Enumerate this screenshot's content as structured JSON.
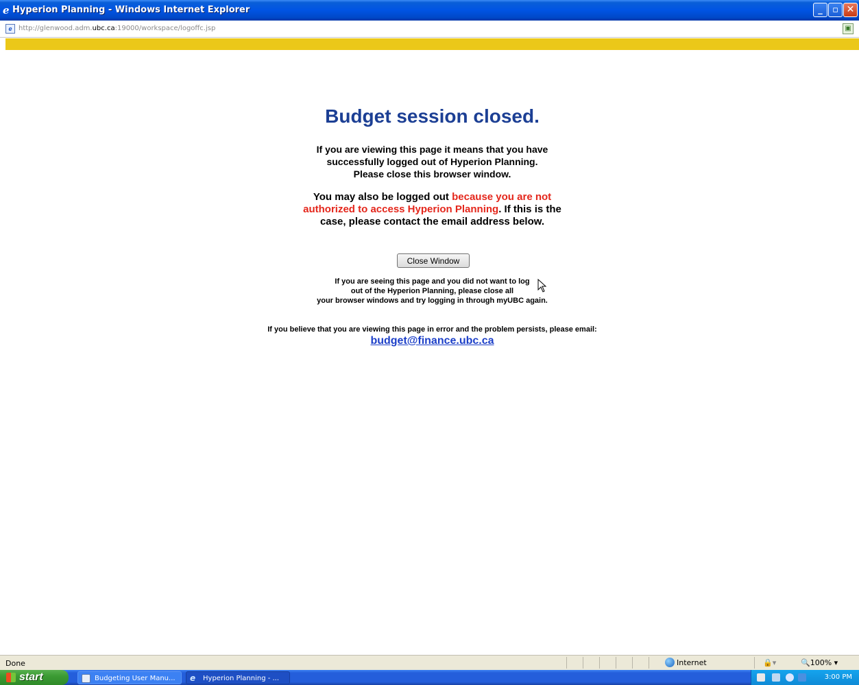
{
  "window": {
    "title": "Hyperion Planning - Windows Internet Explorer",
    "minimize_glyph": "_",
    "maximize_glyph": "▫",
    "close_glyph": "✕"
  },
  "address": {
    "url_prefix": "http://glenwood.adm.",
    "url_domain": "ubc.ca",
    "url_suffix": ":19000/workspace/logoffc.jsp"
  },
  "page": {
    "heading": "Budget session closed.",
    "para1": {
      "line1": "If you are viewing this page it means that you have",
      "line2": "successfully logged out of Hyperion Planning.",
      "line3": "Please close this browser window."
    },
    "para2": {
      "line1_a": "You may also be logged out ",
      "line1_red": "because you are not",
      "line2_red": "authorized to access Hyperion Planning",
      "line2_b": ". If this is the",
      "line3": "case, please contact the email address below."
    },
    "close_button_label": "Close Window",
    "note": {
      "line1": "If you are seeing this page and you did not want to log",
      "line2": "out of the Hyperion Planning, please close all",
      "line3": "your browser windows and try logging in through myUBC again."
    },
    "error_line": "If you believe that you are viewing this page in error and the problem persists, please email:",
    "email": "budget@finance.ubc.ca"
  },
  "statusbar": {
    "status": "Done",
    "zone": "Internet",
    "zoom": "100%"
  },
  "taskbar": {
    "start_label": "start",
    "tasks": [
      {
        "label": "Budgeting User Manu..."
      },
      {
        "label": "Hyperion Planning - ..."
      }
    ],
    "clock": "3:00 PM"
  },
  "colors": {
    "heading": "#1c3f94",
    "warning_red": "#e4261b",
    "link": "#1c3fc8",
    "banner_yellow": "#ebc819"
  }
}
